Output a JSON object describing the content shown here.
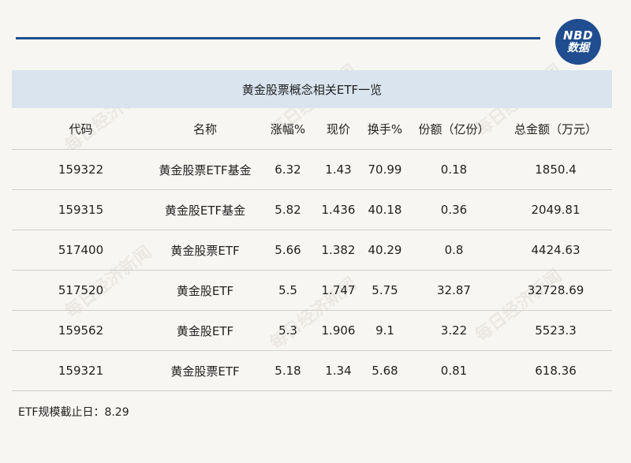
{
  "brand": {
    "line1": "NBD",
    "line2": "数据"
  },
  "watermark_text": "每日经济新闻",
  "table": {
    "title": "黄金股票概念相关ETF一览",
    "headers": [
      "代码",
      "名称",
      "涨幅%",
      "现价",
      "换手%",
      "份额（亿份）",
      "总金额（万元）"
    ],
    "rows": [
      [
        "159322",
        "黄金股票ETF基金",
        "6.32",
        "1.43",
        "70.99",
        "0.18",
        "1850.4"
      ],
      [
        "159315",
        "黄金股ETF基金",
        "5.82",
        "1.436",
        "40.18",
        "0.36",
        "2049.81"
      ],
      [
        "517400",
        "黄金股票ETF",
        "5.66",
        "1.382",
        "40.29",
        "0.8",
        "4424.63"
      ],
      [
        "517520",
        "黄金股ETF",
        "5.5",
        "1.747",
        "5.75",
        "32.87",
        "32728.69"
      ],
      [
        "159562",
        "黄金股ETF",
        "5.3",
        "1.906",
        "9.1",
        "3.22",
        "5523.3"
      ],
      [
        "159321",
        "黄金股票ETF",
        "5.18",
        "1.34",
        "5.68",
        "0.81",
        "618.36"
      ]
    ]
  },
  "footnote": "ETF规模截止日：8.29",
  "colors": {
    "accent": "#1f4d8f",
    "title_bg": "#d9e4ef",
    "page_bg": "#f8f6f2"
  }
}
